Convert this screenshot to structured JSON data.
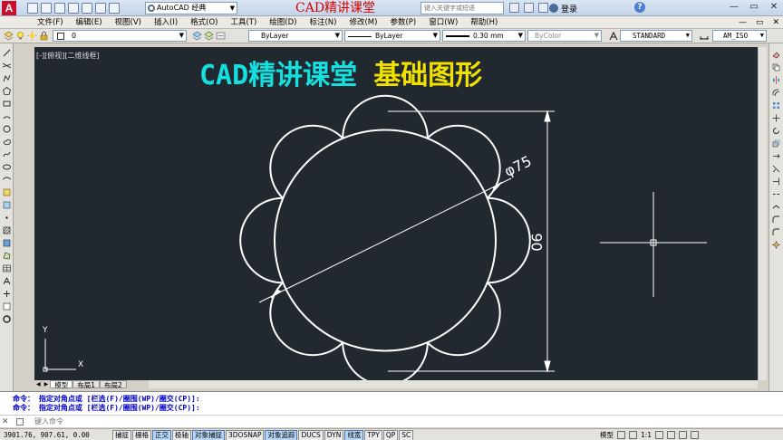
{
  "titlebar": {
    "app_logo": "A",
    "workspace": "AutoCAD 经典",
    "title": "CAD精讲课堂",
    "search_placeholder": "键入关键字或短语",
    "signin": "登录",
    "help": "?",
    "window_buttons": [
      "—",
      "▭",
      "✕"
    ]
  },
  "menubar": {
    "items": [
      "文件(F)",
      "编辑(E)",
      "视图(V)",
      "插入(I)",
      "格式(O)",
      "工具(T)",
      "绘图(D)",
      "标注(N)",
      "修改(M)",
      "参数(P)",
      "窗口(W)",
      "帮助(H)"
    ],
    "mdi_buttons": [
      "—",
      "▭",
      "✕"
    ]
  },
  "toolbar": {
    "layer_name": "0",
    "color": "ByLayer",
    "linetype": "ByLayer",
    "lineweight": "0.30 mm",
    "plotstyle": "ByColor",
    "text_style": "STANDARD",
    "dim_style": "AM_ISO"
  },
  "canvas": {
    "viewport_label": "[-][俯视][二维线框]",
    "heading_left": "CAD精讲课堂",
    "heading_right": "基础图形",
    "dim_diameter": "φ75",
    "dim_height": "90",
    "ucs_x": "X",
    "ucs_y": "Y",
    "colors": {
      "background": "#212830",
      "lines": "#ffffff",
      "heading_left": "#14e0e0",
      "heading_right": "#f0e000"
    }
  },
  "layout_tabs": {
    "nav": [
      "◀",
      "▶"
    ],
    "tabs": [
      "模型",
      "布局1",
      "布局2"
    ]
  },
  "command": {
    "history": [
      "命令： 指定对角点或 [栏选(F)/圈围(WP)/圈交(CP)]:",
      "命令： 指定对角点或 [栏选(F)/圈围(WP)/圈交(CP)]:"
    ],
    "input_placeholder": "键入命令"
  },
  "statusbar": {
    "coords": "3901.76, 907.61, 0.00",
    "buttons": [
      {
        "label": "捕捉",
        "on": false
      },
      {
        "label": "栅格",
        "on": false
      },
      {
        "label": "正交",
        "on": true
      },
      {
        "label": "极轴",
        "on": false
      },
      {
        "label": "对象捕捉",
        "on": true
      },
      {
        "label": "3DOSNAP",
        "on": false
      },
      {
        "label": "对象追踪",
        "on": true
      },
      {
        "label": "DUCS",
        "on": false
      },
      {
        "label": "DYN",
        "on": false
      },
      {
        "label": "线宽",
        "on": true
      },
      {
        "label": "TPY",
        "on": false
      },
      {
        "label": "QP",
        "on": false
      },
      {
        "label": "SC",
        "on": false
      }
    ],
    "model_label": "模型",
    "scale": "1:1"
  }
}
